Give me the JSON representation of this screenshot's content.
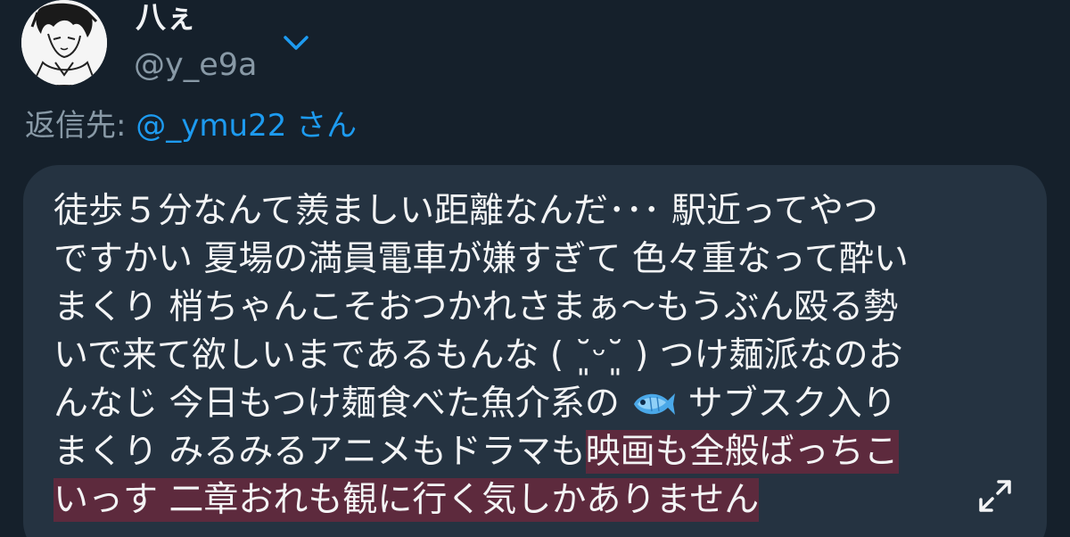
{
  "author": {
    "display_name": "八ぇ",
    "handle": "@y_e9a"
  },
  "reply": {
    "prefix": "返信先:",
    "mention": "@_ymu22",
    "suffix": "さん"
  },
  "message": {
    "lines": [
      "徒歩５分なんて羨ましい距離なんだ･･･ 駅近ってやつ",
      "ですかい 夏場の満員電車が嫌すぎて 色々重なって酔い",
      "まくり 梢ちゃんこそおつかれさまぁ〜もうぶん殴る勢",
      "いで来て欲しいまであるもんな ( ˘͈ᵕ˘͈ ) つけ麺派なのお",
      "んなじ 今日もつけ麺食べた魚介系の",
      " サブスク入り",
      "まくり みるみるアニメもドラマも",
      "映画も全般ばっちこ",
      "いっす 二章おれも観に行く気しかありません"
    ],
    "emoji": "fish-emoji"
  },
  "icons": {
    "chevron": "chevron-down-icon",
    "expand": "expand-icon"
  },
  "colors": {
    "background": "#15202b",
    "bubble": "#253341",
    "highlight": "#5d2a3d",
    "accent": "#1d9bf0",
    "muted": "#8899a6"
  }
}
